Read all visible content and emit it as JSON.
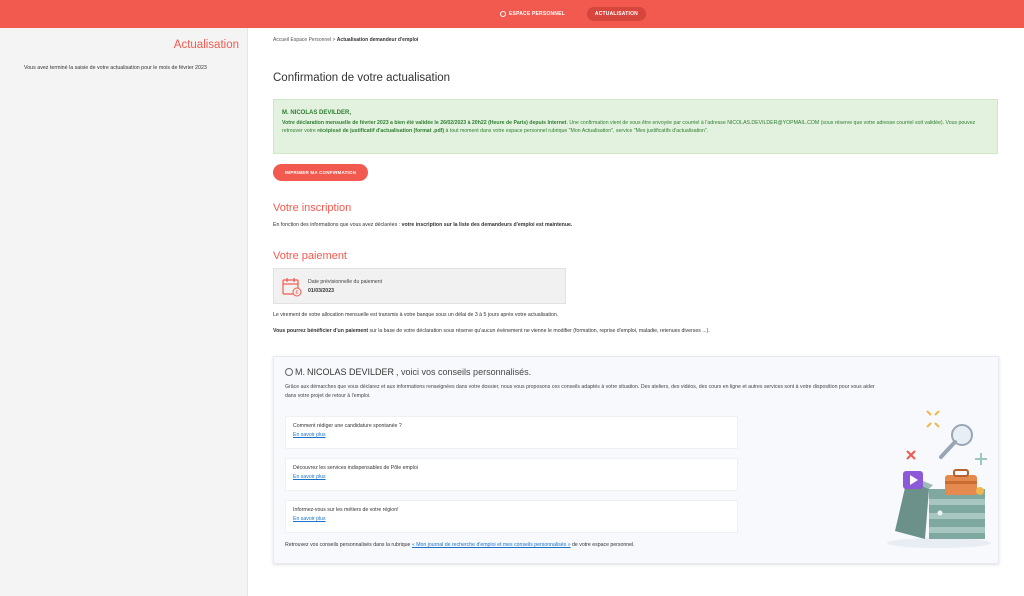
{
  "topnav": {
    "espace_label": "ESPACE PERSONNEL",
    "actualisation_label": "ACTUALISATION"
  },
  "left": {
    "title": "Actualisation",
    "text": "Vous avez terminé la saisie de votre actualisation pour le mois de février 2023"
  },
  "breadcrumb": {
    "home": "Accueil Espace Personnel",
    "sep": ">",
    "current": "Actualisation demandeur d'emploi"
  },
  "page_title": "Confirmation de votre actualisation",
  "confirmation": {
    "name": "M. NICOLAS DEVILDER,",
    "bold1": "Votre déclaration mensuelle de février 2023 a bien été validée le 26/02/2023 à 20h22 (Heure de Paris) depuis Internet",
    "text1": ". Une confirmation vient de vous être envoyée par courriel à l'adresse NICOLAS.DEVILDER@YOPMAIL.COM (sous réserve que votre adresse courriel soit validée). Vous pouvez retrouver votre ",
    "bold2": "récépissé de justificatif d'actualisation (format .pdf)",
    "text2": " à tout moment dans votre espace personnel rubrique \"Mon Actualisation\", service \"Mes justificatifs d'actualisation\"."
  },
  "print_button": "IMPRIMER MA CONFIRMATION",
  "inscription": {
    "title": "Votre inscription",
    "text": "En fonction des informations que vous avez déclarées : ",
    "bold": "votre inscription sur la liste des demandeurs d'emploi est maintenue."
  },
  "paiement": {
    "title": "Votre paiement",
    "label": "Date prévisionnelle du paiement",
    "date": "01/03/2023",
    "text1": "Le virement de votre allocation mensuelle est transmis à votre banque sous un délai de 3 à 5 jours après votre actualisation.",
    "bold2": "Vous pourrez bénéficier d'un paiement",
    "text2": " sur la base de votre déclaration sous réserve qu'aucun évènement ne vienne le modifier (formation, reprise d'emploi, maladie, retenues diverses ...)."
  },
  "advice": {
    "title_prefix": "M.",
    "title_name": "NICOLAS DEVILDER",
    "title_suffix": ", voici vos conseils personnalisés.",
    "intro": "Grâce aux démarches que vous déclarez et aux informations renseignées dans votre dossier, nous vous proposons ces conseils adaptés à votre situation. Des ateliers, des vidéos, des cours en ligne et autres services sont à votre disposition pour vous aider dans votre projet de retour à l'emploi.",
    "tips": [
      {
        "question": "Comment rédiger une candidature spontanée ?",
        "link": "En savoir plus"
      },
      {
        "question": "Découvrez les services indispensables de Pôle emploi",
        "link": "En savoir plus"
      },
      {
        "question": "Informez-vous sur les métiers de votre région!",
        "link": "En savoir plus"
      }
    ],
    "footer_text": "Retrouvez vos conseils personnalisés dans la rubrique ",
    "footer_link": "« Mon journal de recherche d'emploi et mes conseils personnalisés »",
    "footer_end": " de votre espace personnel."
  },
  "colors": {
    "brand": "#f25a4f",
    "success_bg": "#e3f2df",
    "success_text": "#2e7d32",
    "link": "#1a73c9"
  }
}
